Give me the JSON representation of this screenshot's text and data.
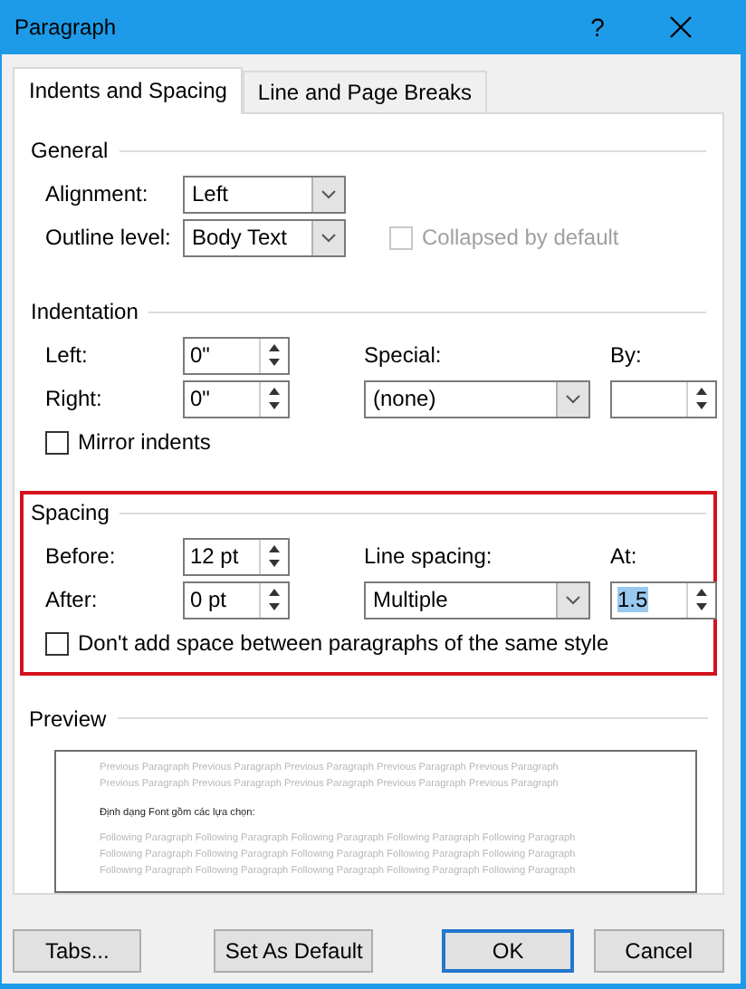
{
  "window": {
    "title": "Paragraph",
    "help": "?"
  },
  "tabs": [
    {
      "label": "Indents and Spacing",
      "selected": true
    },
    {
      "label": "Line and Page Breaks",
      "selected": false
    }
  ],
  "general": {
    "heading": "General",
    "alignment": {
      "label": "Alignment:",
      "value": "Left"
    },
    "outline_level": {
      "label": "Outline level:",
      "value": "Body Text"
    },
    "collapsed": {
      "label": "Collapsed by default",
      "checked": false,
      "disabled": true
    }
  },
  "indentation": {
    "heading": "Indentation",
    "left": {
      "label": "Left:",
      "value": "0\""
    },
    "right": {
      "label": "Right:",
      "value": "0\""
    },
    "special": {
      "label": "Special:",
      "value": "(none)"
    },
    "by": {
      "label": "By:"
    },
    "mirror": {
      "label": "Mirror indents",
      "checked": false
    }
  },
  "spacing": {
    "heading": "Spacing",
    "highlighted": true,
    "before": {
      "label": "Before:",
      "value": "12 pt"
    },
    "after": {
      "label": "After:",
      "value": "0 pt"
    },
    "line_spacing": {
      "label": "Line spacing:",
      "value": "Multiple"
    },
    "at": {
      "label": "At:",
      "value": "1.5",
      "text_selected": true
    },
    "dont_add": {
      "label": "Don't add space between paragraphs of the same style",
      "checked": false
    }
  },
  "preview": {
    "heading": "Preview",
    "lines": [
      {
        "kind": "previous",
        "text": "Previous Paragraph Previous Paragraph Previous Paragraph Previous Paragraph Previous Paragraph"
      },
      {
        "kind": "previous",
        "text": "Previous Paragraph Previous Paragraph Previous Paragraph Previous Paragraph Previous Paragraph"
      },
      {
        "kind": "current",
        "text": "Định dạng Font gồm các lựa chọn:"
      },
      {
        "kind": "following",
        "text": "Following Paragraph Following Paragraph Following Paragraph Following Paragraph Following Paragraph"
      },
      {
        "kind": "following",
        "text": "Following Paragraph Following Paragraph Following Paragraph Following Paragraph Following Paragraph"
      },
      {
        "kind": "following",
        "text": "Following Paragraph Following Paragraph Following Paragraph Following Paragraph Following Paragraph"
      }
    ]
  },
  "buttons": [
    {
      "label": "Tabs...",
      "default": false
    },
    {
      "label": "Set As Default",
      "default": false
    },
    {
      "label": "OK",
      "default": true
    },
    {
      "label": "Cancel",
      "default": false
    }
  ]
}
